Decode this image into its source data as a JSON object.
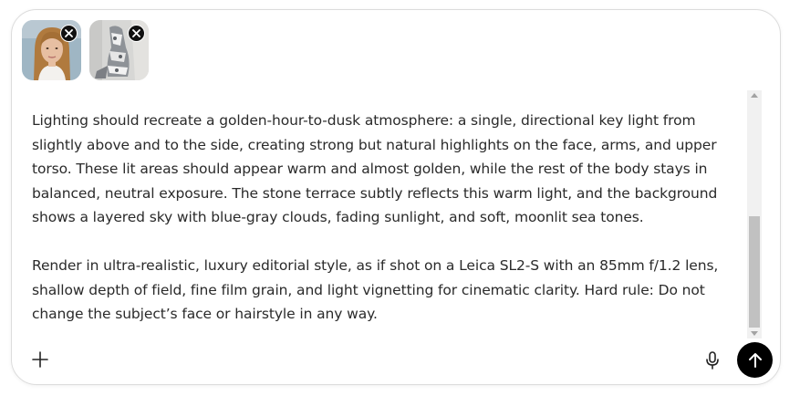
{
  "composer": {
    "attachments": [
      {
        "name": "portrait-photo",
        "remove_icon": "close-icon"
      },
      {
        "name": "mannequin-photo",
        "remove_icon": "close-icon"
      }
    ],
    "prompt": {
      "paragraph_1": "Lighting should recreate a golden-hour-to-dusk atmosphere: a single, directional key light from slightly above and to the side, creating strong but natural highlights on the face, arms, and upper torso. These lit areas should appear warm and almost golden, while the rest of the body stays in balanced, neutral exposure. The stone terrace subtly reflects this warm light, and the background shows a layered sky with blue-gray clouds, fading sunlight, and soft, moonlit sea tones.",
      "paragraph_2": "Render in ultra-realistic, luxury editorial style, as if shot on a Leica SL2-S with an 85mm f/1.2 lens, shallow depth of field, fine film grain, and light vignetting for cinematic clarity. Hard rule: Do not change the subject’s face or hairstyle in any way."
    },
    "toolbar": {
      "add_icon": "plus-icon",
      "voice_icon": "microphone-icon",
      "send_icon": "arrow-up-icon"
    }
  },
  "colors": {
    "send_button": "#000000",
    "text": "#2a2a2a",
    "border": "#dcdcdc"
  }
}
